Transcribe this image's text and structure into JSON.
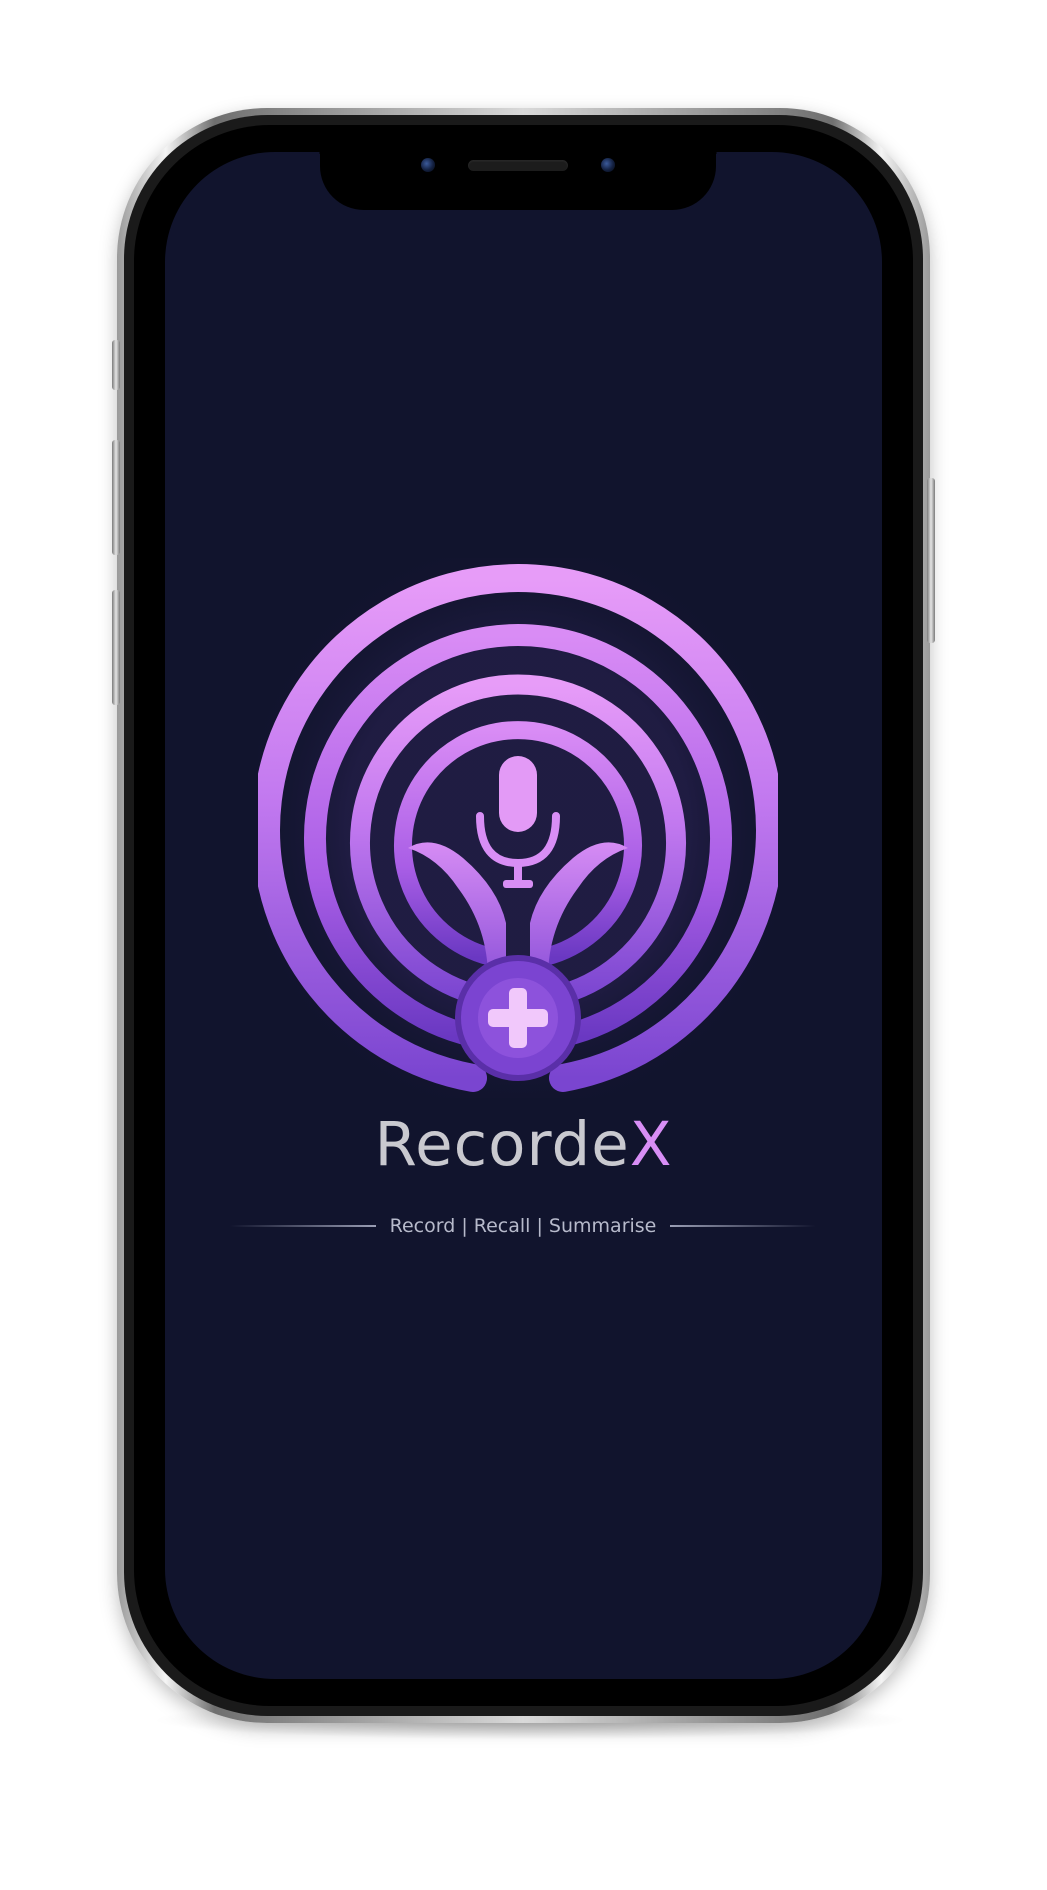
{
  "app": {
    "name_main": "Recorde",
    "name_accent": "X",
    "tagline": "Record | Recall | Summarise"
  },
  "logo": {
    "icon_names": [
      "concentric-rings-icon",
      "microphone-icon",
      "plus-icon"
    ]
  },
  "colors": {
    "screen_background": "#11142d",
    "brand_purple": "#b467e6",
    "brand_pink": "#e38ef7",
    "deep_purple": "#6b3cc4",
    "name_text": "#c9c9cf",
    "tagline_text": "#b7bacb"
  }
}
